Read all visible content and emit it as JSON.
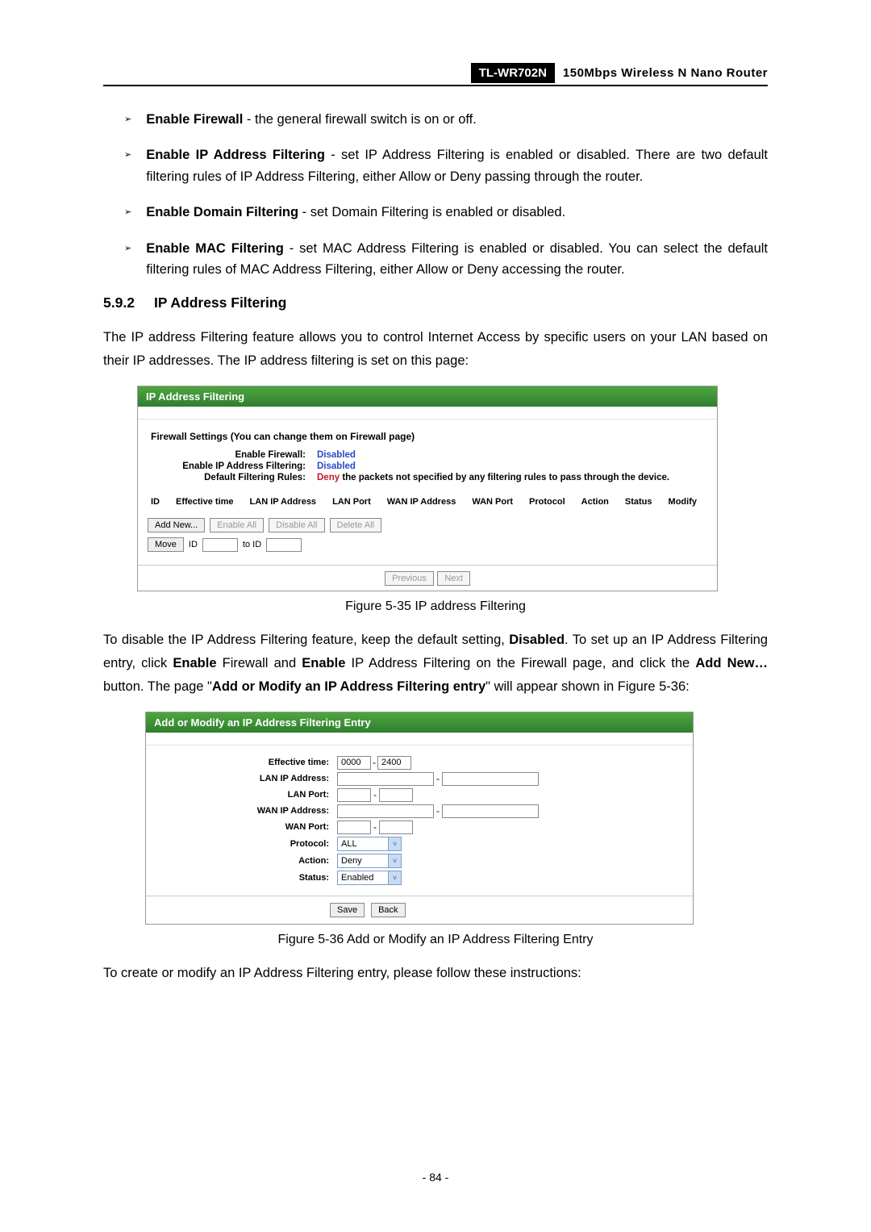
{
  "header": {
    "model": "TL-WR702N",
    "desc": "150Mbps Wireless N Nano Router"
  },
  "bullets": [
    {
      "term": "Enable Firewall",
      "text": " - the general firewall switch is on or off."
    },
    {
      "term": "Enable IP Address Filtering",
      "text": " - set IP Address Filtering is enabled or disabled. There are two default filtering rules of IP Address Filtering, either Allow or Deny passing through the router."
    },
    {
      "term": "Enable Domain Filtering",
      "text": " - set Domain Filtering is enabled or disabled."
    },
    {
      "term": "Enable MAC Filtering",
      "text": " - set MAC Address Filtering is enabled or disabled. You can select the default filtering rules of MAC Address Filtering, either Allow or Deny accessing the router."
    }
  ],
  "section": {
    "num": "5.9.2",
    "title": "IP Address Filtering"
  },
  "para1": "The IP address Filtering feature allows you to control Internet Access by specific users on your LAN based on their IP addresses. The IP address filtering is set on this page:",
  "fig35": {
    "header": "IP Address Filtering",
    "settings_title": "Firewall Settings (You can change them on Firewall page)",
    "rows": [
      {
        "label": "Enable Firewall:",
        "value": "Disabled",
        "cls": "blue"
      },
      {
        "label": "Enable IP Address Filtering:",
        "value": "Disabled",
        "cls": "blue"
      },
      {
        "label": "Default Filtering Rules:",
        "deny": "Deny",
        "rest": " the packets not specified by any filtering rules to pass through the device.",
        "cls": "red"
      }
    ],
    "columns": [
      "ID",
      "Effective time",
      "LAN IP Address",
      "LAN Port",
      "WAN IP Address",
      "WAN Port",
      "Protocol",
      "Action",
      "Status",
      "Modify"
    ],
    "buttons": {
      "addnew": "Add New...",
      "enableall": "Enable All",
      "disableall": "Disable All",
      "deleteall": "Delete All",
      "move": "Move",
      "id_label": "ID",
      "to_id": "to ID",
      "previous": "Previous",
      "next": "Next"
    }
  },
  "caption35": "Figure 5-35 IP address Filtering",
  "para2": {
    "t1": "To disable the IP Address Filtering feature, keep the default setting, ",
    "b1": "Disabled",
    "t2": ". To set up an IP Address Filtering entry, click ",
    "b2": "Enable",
    "t3": " Firewall and ",
    "b3": "Enable",
    "t4": " IP Address Filtering on the Firewall page, and click the ",
    "b4": "Add New…",
    "t5": " button. The page \"",
    "b5": "Add or Modify an IP Address Filtering entry",
    "t6": "\" will appear shown in Figure 5-36:"
  },
  "fig36": {
    "header": "Add or Modify an IP Address Filtering Entry",
    "fields": {
      "effective_time": "Effective time:",
      "lan_ip": "LAN IP Address:",
      "lan_port": "LAN Port:",
      "wan_ip": "WAN IP Address:",
      "wan_port": "WAN Port:",
      "protocol": "Protocol:",
      "action": "Action:",
      "status": "Status:"
    },
    "values": {
      "time_from": "0000",
      "time_to": "2400",
      "protocol": "ALL",
      "action": "Deny",
      "status": "Enabled"
    },
    "buttons": {
      "save": "Save",
      "back": "Back"
    }
  },
  "caption36": "Figure 5-36 Add or Modify an IP Address Filtering Entry",
  "para3": "To create or modify an IP Address Filtering entry, please follow these instructions:",
  "page_number": "- 84 -"
}
